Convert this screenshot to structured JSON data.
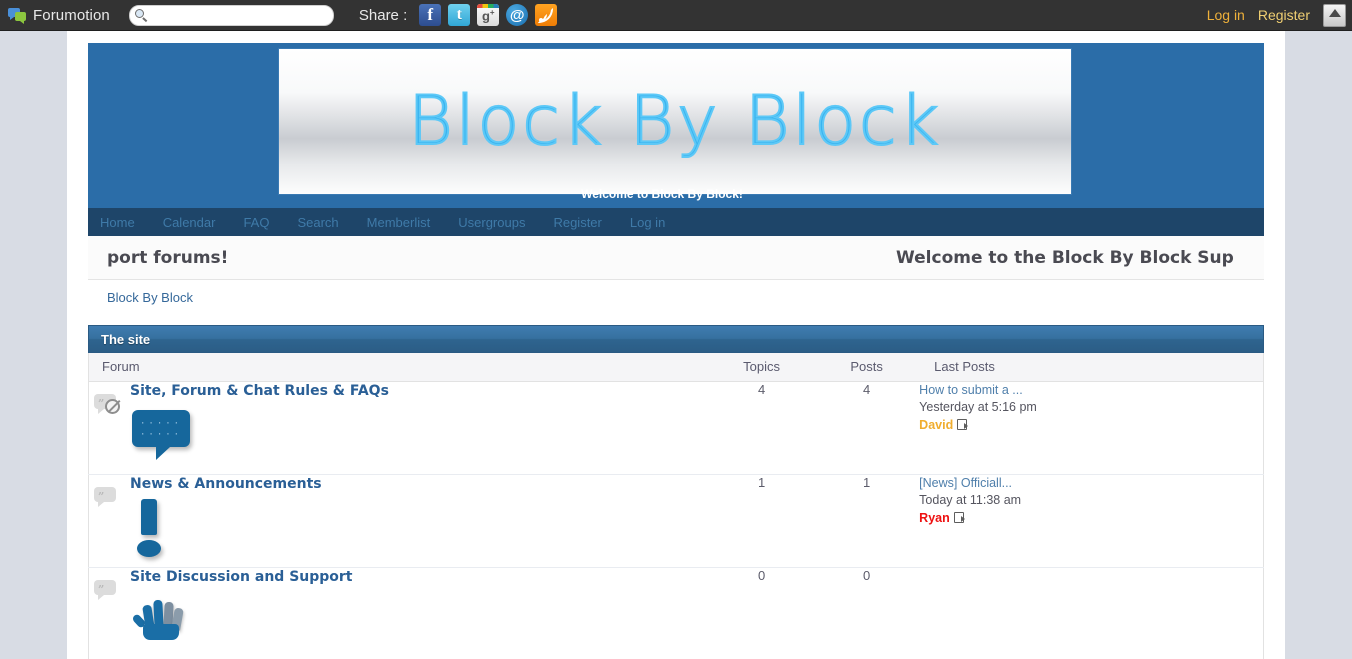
{
  "forumotion_bar": {
    "brand": "Forumotion",
    "brand_icon": "chat-bubbles-icon",
    "search": {
      "value": "",
      "placeholder": "",
      "icon": "search-icon"
    },
    "share_label": "Share :",
    "social": [
      {
        "name": "facebook-icon",
        "glyph": "f"
      },
      {
        "name": "twitter-icon",
        "glyph": "t"
      },
      {
        "name": "google-plus-icon",
        "glyph": "g+"
      },
      {
        "name": "email-share-icon",
        "glyph": "@"
      },
      {
        "name": "rss-icon",
        "glyph": ""
      }
    ],
    "login_label": "Log in",
    "register_label": "Register",
    "scroll_top_icon": "arrow-up-icon"
  },
  "header": {
    "banner_text": "Block By Block",
    "welcome_line": "Welcome to Block By Block!"
  },
  "nav": {
    "items": [
      {
        "label": "Home"
      },
      {
        "label": "Calendar"
      },
      {
        "label": "FAQ"
      },
      {
        "label": "Search"
      },
      {
        "label": "Memberlist"
      },
      {
        "label": "Usergroups"
      },
      {
        "label": "Register"
      },
      {
        "label": "Log in"
      }
    ]
  },
  "marquee": {
    "full_text": "Welcome to the Block By Block Support forums!",
    "visible_tail": "port forums!",
    "visible_head": "Welcome to the Block By Block Sup"
  },
  "breadcrumb": {
    "items": [
      {
        "label": "Block By Block"
      }
    ]
  },
  "category": {
    "title": "The site",
    "columns": {
      "forum": "Forum",
      "topics": "Topics",
      "posts": "Posts",
      "last_posts": "Last Posts"
    },
    "forums": [
      {
        "title": "Site, Forum & Chat Rules & FAQs",
        "status_icon": "locked-forum-icon",
        "art_icon": "speech-bubble-art",
        "topics": "4",
        "posts": "4",
        "last_post": {
          "title": "How to submit a ...",
          "date": "Yesterday at 5:16 pm",
          "author": "David",
          "author_color": "#f0ad2e",
          "goto_icon": "goto-last-post-icon"
        }
      },
      {
        "title": "News & Announcements",
        "status_icon": "no-new-posts-icon",
        "art_icon": "exclamation-art",
        "topics": "1",
        "posts": "1",
        "last_post": {
          "title": "[News] Officiall...",
          "date": "Today at 11:38 am",
          "author": "Ryan",
          "author_color": "#ee1111",
          "goto_icon": "goto-last-post-icon"
        }
      },
      {
        "title": "Site Discussion and Support",
        "status_icon": "no-new-posts-icon",
        "art_icon": "hand-art",
        "topics": "0",
        "posts": "0",
        "last_post": {
          "title": "",
          "date": "",
          "author": "",
          "author_color": "#55555f",
          "goto_icon": ""
        }
      }
    ]
  },
  "colors": {
    "page_bg": "#d8dce4",
    "header_blue": "#2b6da8",
    "nav_navy": "#1e4569",
    "category_blue": "#36709f",
    "link_blue": "#2a5f96",
    "banner_stroke": "#5cc8f7"
  }
}
